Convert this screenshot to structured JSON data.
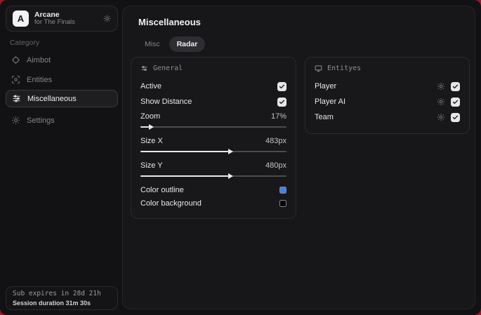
{
  "profile": {
    "name": "Arcane",
    "subtitle": "for The Finals",
    "avatar_letter": "A"
  },
  "sidebar": {
    "category_label": "Category",
    "items": [
      {
        "label": "Aimbot",
        "icon": "crosshair-icon",
        "selected": false
      },
      {
        "label": "Entities",
        "icon": "scan-icon",
        "selected": false
      },
      {
        "label": "Miscellaneous",
        "icon": "sliders-icon",
        "selected": true
      },
      {
        "label": "Settings",
        "icon": "gear-icon",
        "selected": false
      }
    ],
    "footer": {
      "sub_expires": "Sub expires in 28d 21h",
      "session_duration": "Session duration 31m 30s"
    }
  },
  "main": {
    "title": "Miscellaneous",
    "tabs": [
      {
        "label": "Misc",
        "active": false
      },
      {
        "label": "Radar",
        "active": true
      }
    ],
    "general": {
      "header": "General",
      "toggles": [
        {
          "label": "Active",
          "checked": true
        },
        {
          "label": "Show Distance",
          "checked": true
        }
      ],
      "sliders": [
        {
          "label": "Zoom",
          "value": "17%",
          "fill_pct": 6
        },
        {
          "label": "Size X",
          "value": "483px",
          "fill_pct": 60
        },
        {
          "label": "Size Y",
          "value": "480px",
          "fill_pct": 60
        }
      ],
      "colors": [
        {
          "label": "Color outline",
          "hex": "#3b82f6"
        },
        {
          "label": "Color background",
          "hex": "#000000"
        }
      ]
    },
    "entities_panel": {
      "header": "Entityes",
      "rows": [
        {
          "label": "Player",
          "checked": true
        },
        {
          "label": "Player AI",
          "checked": true
        },
        {
          "label": "Team",
          "checked": true
        }
      ]
    }
  },
  "colors": {
    "backdrop_accent": "#9c1727",
    "tab_active_bg": "#2e2e32",
    "checkbox_bg": "#e7e7ea"
  }
}
